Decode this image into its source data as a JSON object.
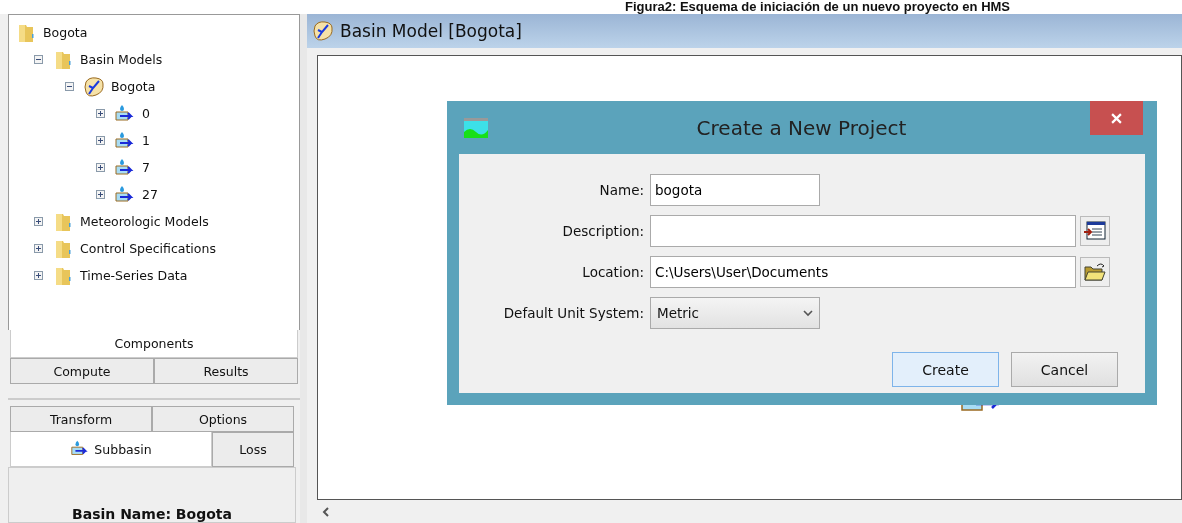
{
  "caption": "Figura2: Esquema de iniciación de un nuevo proyecto en HMS",
  "tree": [
    {
      "label": "Bogota",
      "kind": "folder",
      "children": [
        {
          "label": "Basin Models",
          "kind": "folder",
          "expanded": true,
          "children": [
            {
              "label": "Bogota",
              "kind": "basin",
              "expanded": true,
              "children": [
                {
                  "label": "0",
                  "kind": "subbasin",
                  "expanded": false
                },
                {
                  "label": "1",
                  "kind": "subbasin",
                  "expanded": false
                },
                {
                  "label": "7",
                  "kind": "subbasin",
                  "expanded": false
                },
                {
                  "label": "27",
                  "kind": "subbasin",
                  "expanded": false
                }
              ]
            }
          ]
        },
        {
          "label": "Meteorologic Models",
          "kind": "folder",
          "expanded": false
        },
        {
          "label": "Control Specifications",
          "kind": "folder",
          "expanded": false
        },
        {
          "label": "Time-Series Data",
          "kind": "folder",
          "expanded": false
        }
      ]
    }
  ],
  "explorer_tabs": [
    [
      {
        "label": "Components",
        "selected": true
      }
    ],
    [
      {
        "label": "Compute",
        "selected": false
      },
      {
        "label": "Results",
        "selected": false
      }
    ]
  ],
  "editor_tabs": [
    [
      {
        "label": "Transform",
        "selected": false
      },
      {
        "label": "Options",
        "selected": false
      }
    ],
    [
      {
        "label": "Subbasin",
        "selected": true,
        "kind": "subbasin"
      },
      {
        "label": "Loss",
        "selected": false
      }
    ]
  ],
  "basin_name": "Basin Name: Bogota",
  "desktop": {
    "title": "Basin Model [Bogota]"
  },
  "dialog": {
    "title": "Create a New Project",
    "fields": [
      {
        "label": "Name:",
        "kind": "short",
        "value": "bogota"
      },
      {
        "label": "Description:",
        "kind": "notes"
      },
      {
        "label": "Location:",
        "kind": "browse",
        "value": "C:\\Users\\User\\Documents"
      },
      {
        "label": "Default Unit System:",
        "kind": "select",
        "value": "Metric"
      }
    ],
    "buttons": [
      {
        "label": "Create",
        "default": true
      },
      {
        "label": "Cancel",
        "default": false
      }
    ]
  }
}
